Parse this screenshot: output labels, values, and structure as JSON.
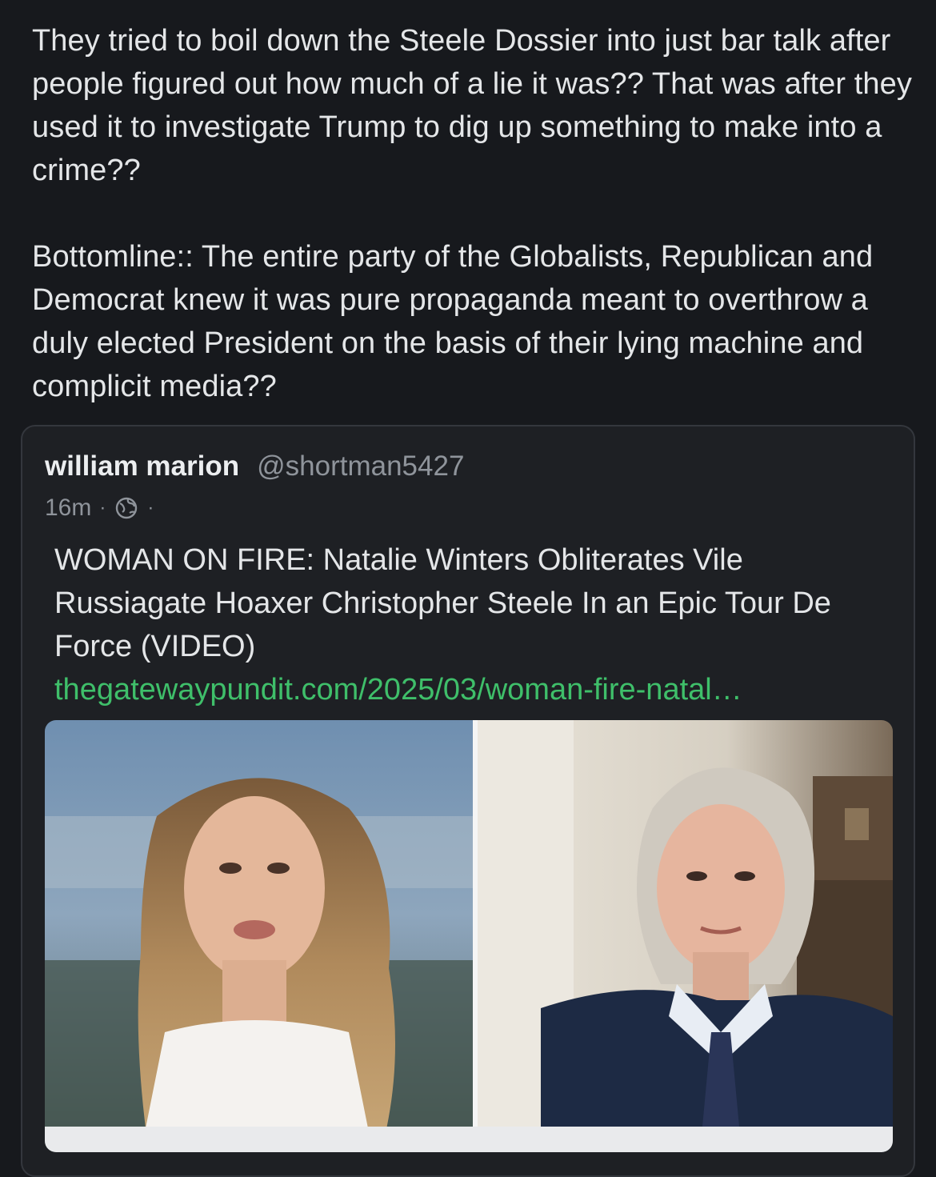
{
  "post": {
    "paragraph1": "They tried to boil down the Steele Dossier into just bar talk after people figured out how much of a lie it was?? That was after they used it to investigate Trump to dig up something to make into a crime??",
    "paragraph2": "Bottomline:: The entire party of the Globalists, Republican and Democrat knew it was pure propaganda meant to overthrow a duly elected President on the basis of their lying machine and complicit media??"
  },
  "quote": {
    "author_name": "william marion",
    "author_handle": "@shortman5427",
    "time": "16m",
    "meta_separator": "·",
    "visibility_icon": "globe-icon",
    "title": "WOMAN ON FIRE: Natalie Winters Obliterates Vile Russiagate Hoaxer Christopher Steele In an Epic Tour De Force (VIDEO)",
    "link": "thegatewaypundit.com/2025/03/woman-fire-natal…",
    "image_description_icon": "split-screen-interview-image"
  },
  "colors": {
    "background": "#17191d",
    "card": "#1e2024",
    "link": "#3fbf6a",
    "muted": "#8f949b"
  }
}
